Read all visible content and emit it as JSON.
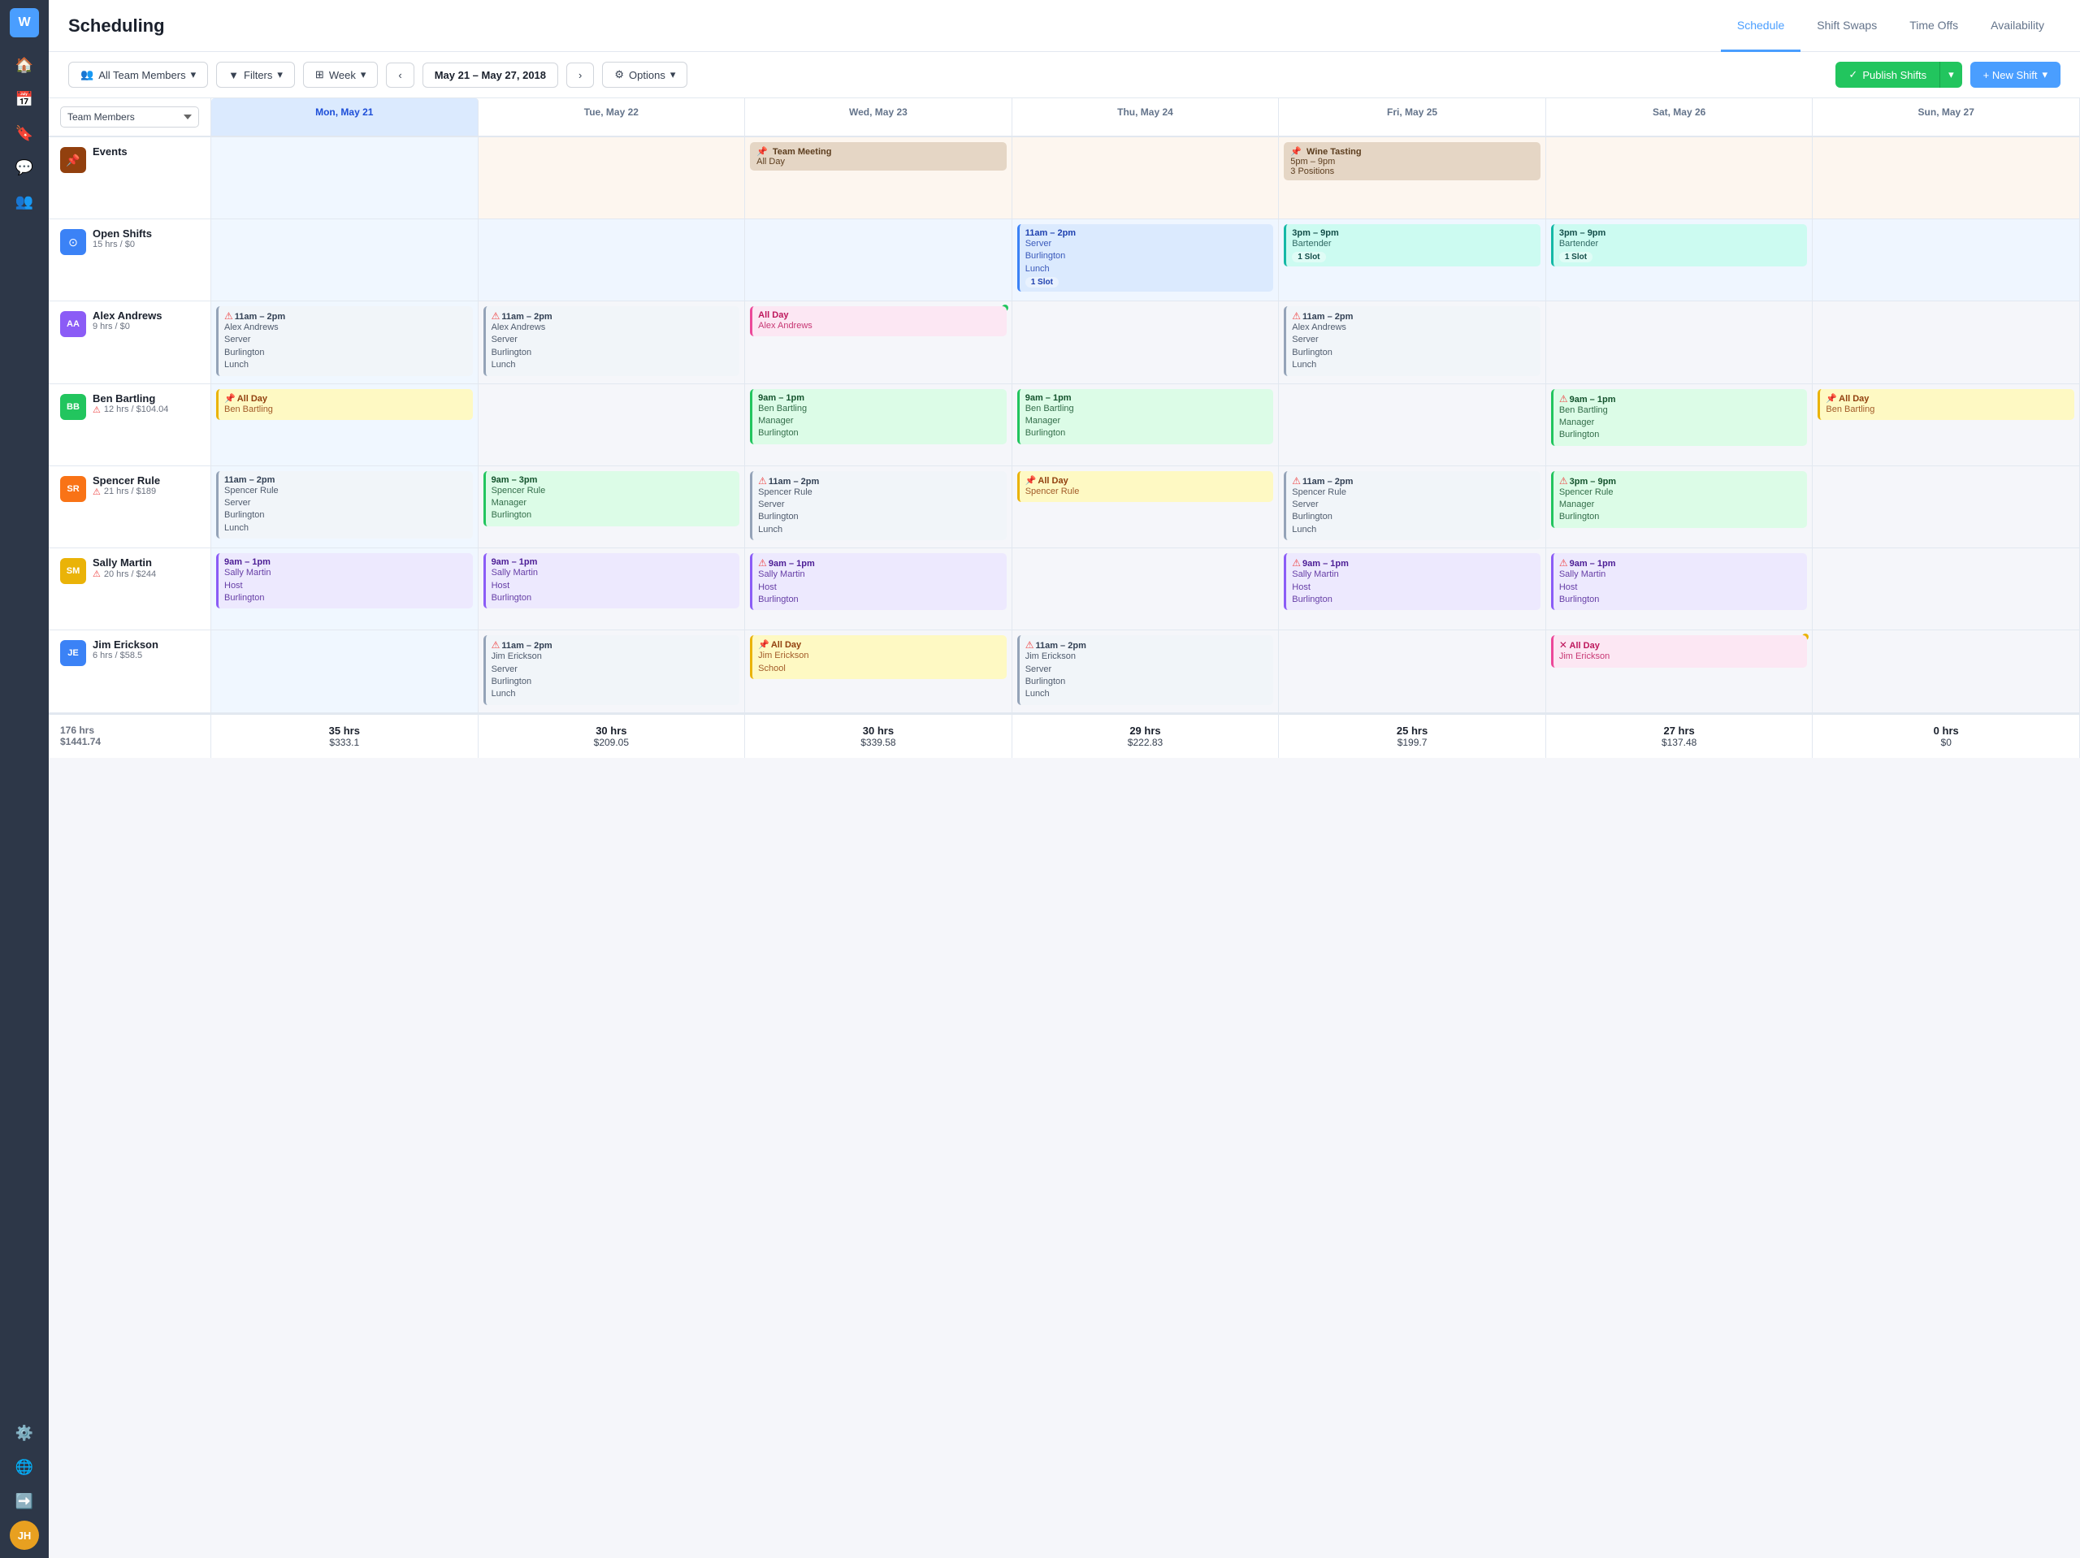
{
  "app": {
    "logo": "W",
    "title": "Scheduling"
  },
  "nav": {
    "tabs": [
      {
        "id": "schedule",
        "label": "Schedule",
        "active": true
      },
      {
        "id": "shift-swaps",
        "label": "Shift Swaps",
        "active": false
      },
      {
        "id": "time-offs",
        "label": "Time Offs",
        "active": false
      },
      {
        "id": "availability",
        "label": "Availability",
        "active": false
      }
    ]
  },
  "toolbar": {
    "team_members": "All Team Members",
    "filters": "Filters",
    "week": "Week",
    "date_range": "May 21 – May 27, 2018",
    "options": "Options",
    "publish_shifts": "Publish Shifts",
    "new_shift": "+ New Shift"
  },
  "calendar": {
    "corner_label": "Team Members",
    "days": [
      {
        "label": "Mon, May 21",
        "today": true
      },
      {
        "label": "Tue, May 22",
        "today": false
      },
      {
        "label": "Wed, May 23",
        "today": false
      },
      {
        "label": "Thu, May 24",
        "today": false
      },
      {
        "label": "Fri, May 25",
        "today": false
      },
      {
        "label": "Sat, May 26",
        "today": false
      },
      {
        "label": "Sun, May 27",
        "today": false
      }
    ],
    "rows": [
      {
        "type": "events",
        "icon": "📌",
        "icon_style": "brown",
        "name": "Events",
        "sub": "",
        "cells": [
          {
            "shifts": []
          },
          {
            "shifts": []
          },
          {
            "shifts": [
              {
                "type": "event",
                "time": "Team Meeting",
                "detail": "All Day",
                "style": "event"
              }
            ]
          },
          {
            "shifts": []
          },
          {
            "shifts": [
              {
                "type": "event",
                "time": "Wine Tasting",
                "detail": "5pm – 9pm\n3 Positions",
                "style": "wine",
                "pin": true
              }
            ]
          },
          {
            "shifts": []
          },
          {
            "shifts": []
          }
        ]
      },
      {
        "type": "open-shifts",
        "icon": "⊙",
        "icon_style": "blue",
        "name": "Open Shifts",
        "sub": "15 hrs / $0",
        "cells": [
          {
            "shifts": []
          },
          {
            "shifts": []
          },
          {
            "shifts": []
          },
          {
            "shifts": [
              {
                "type": "shift",
                "time": "11am – 2pm",
                "detail": "Server\nBurlington\nLunch",
                "badge": "1 Slot",
                "style": "shift-blue"
              }
            ]
          },
          {
            "shifts": [
              {
                "type": "shift",
                "time": "3pm – 9pm",
                "detail": "Bartender",
                "badge": "1 Slot",
                "style": "shift-teal"
              }
            ]
          },
          {
            "shifts": [
              {
                "type": "shift",
                "time": "3pm – 9pm",
                "detail": "Bartender",
                "badge": "1 Slot",
                "style": "shift-teal"
              }
            ]
          },
          {
            "shifts": []
          }
        ]
      },
      {
        "type": "person",
        "avatar_text": "AA",
        "avatar_color": "#8b5cf6",
        "name": "Alex Andrews",
        "sub": "9 hrs / $0",
        "has_warning": false,
        "cells": [
          {
            "shifts": [
              {
                "type": "shift",
                "error": true,
                "time": "11am – 2pm",
                "detail": "Alex Andrews\nServer\nBurlington\nLunch",
                "style": "shift-gray"
              }
            ]
          },
          {
            "shifts": [
              {
                "type": "shift",
                "error": true,
                "time": "11am – 2pm",
                "detail": "Alex Andrews\nServer\nBurlington\nLunch",
                "style": "shift-gray"
              }
            ]
          },
          {
            "shifts": [
              {
                "type": "allday",
                "time": "All Day",
                "detail": "Alex Andrews",
                "style": "shift-allday-pink",
                "dot": "green"
              }
            ],
            "today": false
          },
          {
            "shifts": []
          },
          {
            "shifts": [
              {
                "type": "shift",
                "error": true,
                "time": "11am – 2pm",
                "detail": "Alex Andrews\nServer\nBurlington\nLunch",
                "style": "shift-gray"
              }
            ]
          },
          {
            "shifts": []
          },
          {
            "shifts": []
          }
        ]
      },
      {
        "type": "person",
        "avatar_text": "BB",
        "avatar_color": "#22c55e",
        "name": "Ben Bartling",
        "sub": "12 hrs / $104.04",
        "has_warning": true,
        "cells": [
          {
            "shifts": [
              {
                "type": "allday",
                "time": "All Day",
                "detail": "Ben Bartling",
                "style": "shift-allday-yellow",
                "pin": true
              }
            ]
          },
          {
            "shifts": []
          },
          {
            "shifts": [
              {
                "type": "shift",
                "time": "9am – 1pm",
                "detail": "Ben Bartling\nManager\nBurlington",
                "style": "shift-green"
              }
            ]
          },
          {
            "shifts": [
              {
                "type": "shift",
                "time": "9am – 1pm",
                "detail": "Ben Bartling\nManager\nBurlington",
                "style": "shift-green"
              }
            ]
          },
          {
            "shifts": []
          },
          {
            "shifts": [
              {
                "type": "shift",
                "error": true,
                "time": "9am – 1pm",
                "detail": "Ben Bartling\nManager\nBurlington",
                "style": "shift-green"
              }
            ]
          },
          {
            "shifts": [
              {
                "type": "allday",
                "time": "All Day",
                "detail": "Ben Bartling",
                "style": "shift-allday-yellow",
                "pin": true
              }
            ]
          }
        ]
      },
      {
        "type": "person",
        "avatar_text": "SR",
        "avatar_color": "#f97316",
        "name": "Spencer Rule",
        "sub": "21 hrs / $189",
        "has_warning": true,
        "cells": [
          {
            "shifts": [
              {
                "type": "shift",
                "time": "11am – 2pm",
                "detail": "Spencer Rule\nServer\nBurlington\nLunch",
                "style": "shift-gray"
              }
            ]
          },
          {
            "shifts": [
              {
                "type": "shift",
                "time": "9am – 3pm",
                "detail": "Spencer Rule\nManager\nBurlington",
                "style": "shift-green"
              }
            ]
          },
          {
            "shifts": [
              {
                "type": "shift",
                "error": true,
                "time": "11am – 2pm",
                "detail": "Spencer Rule\nServer\nBurlington\nLunch",
                "style": "shift-gray"
              }
            ]
          },
          {
            "shifts": [
              {
                "type": "allday",
                "time": "All Day",
                "detail": "Spencer Rule",
                "style": "shift-allday-yellow",
                "pin": true
              }
            ]
          },
          {
            "shifts": [
              {
                "type": "shift",
                "error": true,
                "time": "11am – 2pm",
                "detail": "Spencer Rule\nServer\nBurlington\nLunch",
                "style": "shift-gray"
              }
            ]
          },
          {
            "shifts": [
              {
                "type": "shift",
                "error": true,
                "time": "3pm – 9pm",
                "detail": "Spencer Rule\nManager\nBurlington",
                "style": "shift-green"
              }
            ]
          },
          {
            "shifts": []
          }
        ]
      },
      {
        "type": "person",
        "avatar_text": "SM",
        "avatar_color": "#eab308",
        "name": "Sally Martin",
        "sub": "20 hrs / $244",
        "has_warning": true,
        "cells": [
          {
            "shifts": [
              {
                "type": "shift",
                "time": "9am – 1pm",
                "detail": "Sally Martin\nHost\nBurlington",
                "style": "shift-purple"
              }
            ]
          },
          {
            "shifts": [
              {
                "type": "shift",
                "time": "9am – 1pm",
                "detail": "Sally Martin\nHost\nBurlington",
                "style": "shift-purple"
              }
            ]
          },
          {
            "shifts": [
              {
                "type": "shift",
                "error": true,
                "time": "9am – 1pm",
                "detail": "Sally Martin\nHost\nBurlington",
                "style": "shift-purple"
              }
            ]
          },
          {
            "shifts": []
          },
          {
            "shifts": [
              {
                "type": "shift",
                "error": true,
                "time": "9am – 1pm",
                "detail": "Sally Martin\nHost\nBurlington",
                "style": "shift-purple"
              }
            ]
          },
          {
            "shifts": [
              {
                "type": "shift",
                "error": true,
                "time": "9am – 1pm",
                "detail": "Sally Martin\nHost\nBurlington",
                "style": "shift-purple"
              }
            ]
          },
          {
            "shifts": []
          }
        ]
      },
      {
        "type": "person",
        "avatar_text": "JE",
        "avatar_color": "#3b82f6",
        "name": "Jim Erickson",
        "sub": "6 hrs / $58.5",
        "has_warning": false,
        "cells": [
          {
            "shifts": []
          },
          {
            "shifts": [
              {
                "type": "shift",
                "error": true,
                "time": "11am – 2pm",
                "detail": "Jim Erickson\nServer\nBurlington\nLunch",
                "style": "shift-gray"
              }
            ]
          },
          {
            "shifts": [
              {
                "type": "allday",
                "time": "All Day",
                "detail": "Jim Erickson\nSchool",
                "style": "shift-allday-yellow",
                "pin": true
              }
            ]
          },
          {
            "shifts": [
              {
                "type": "shift",
                "error": true,
                "time": "11am – 2pm",
                "detail": "Jim Erickson\nServer\nBurlington\nLunch",
                "style": "shift-gray"
              }
            ]
          },
          {
            "shifts": []
          },
          {
            "shifts": [
              {
                "type": "allday",
                "time": "All Day",
                "detail": "Jim Erickson",
                "style": "shift-allday-pink",
                "dot": "yellow"
              }
            ]
          },
          {
            "shifts": []
          }
        ]
      }
    ],
    "footer": {
      "total_label": "176 hrs\n$1441.74",
      "days": [
        {
          "hrs": "35 hrs",
          "amount": "$333.1"
        },
        {
          "hrs": "30 hrs",
          "amount": "$209.05"
        },
        {
          "hrs": "30 hrs",
          "amount": "$339.58"
        },
        {
          "hrs": "29 hrs",
          "amount": "$222.83"
        },
        {
          "hrs": "25 hrs",
          "amount": "$199.7"
        },
        {
          "hrs": "27 hrs",
          "amount": "$137.48"
        },
        {
          "hrs": "0 hrs",
          "amount": "$0"
        }
      ]
    }
  },
  "sidebar": {
    "logo": "W",
    "user_initials": "JH",
    "icons": [
      "🏠",
      "📅",
      "🔖",
      "💬",
      "👥",
      "⚙️"
    ]
  }
}
